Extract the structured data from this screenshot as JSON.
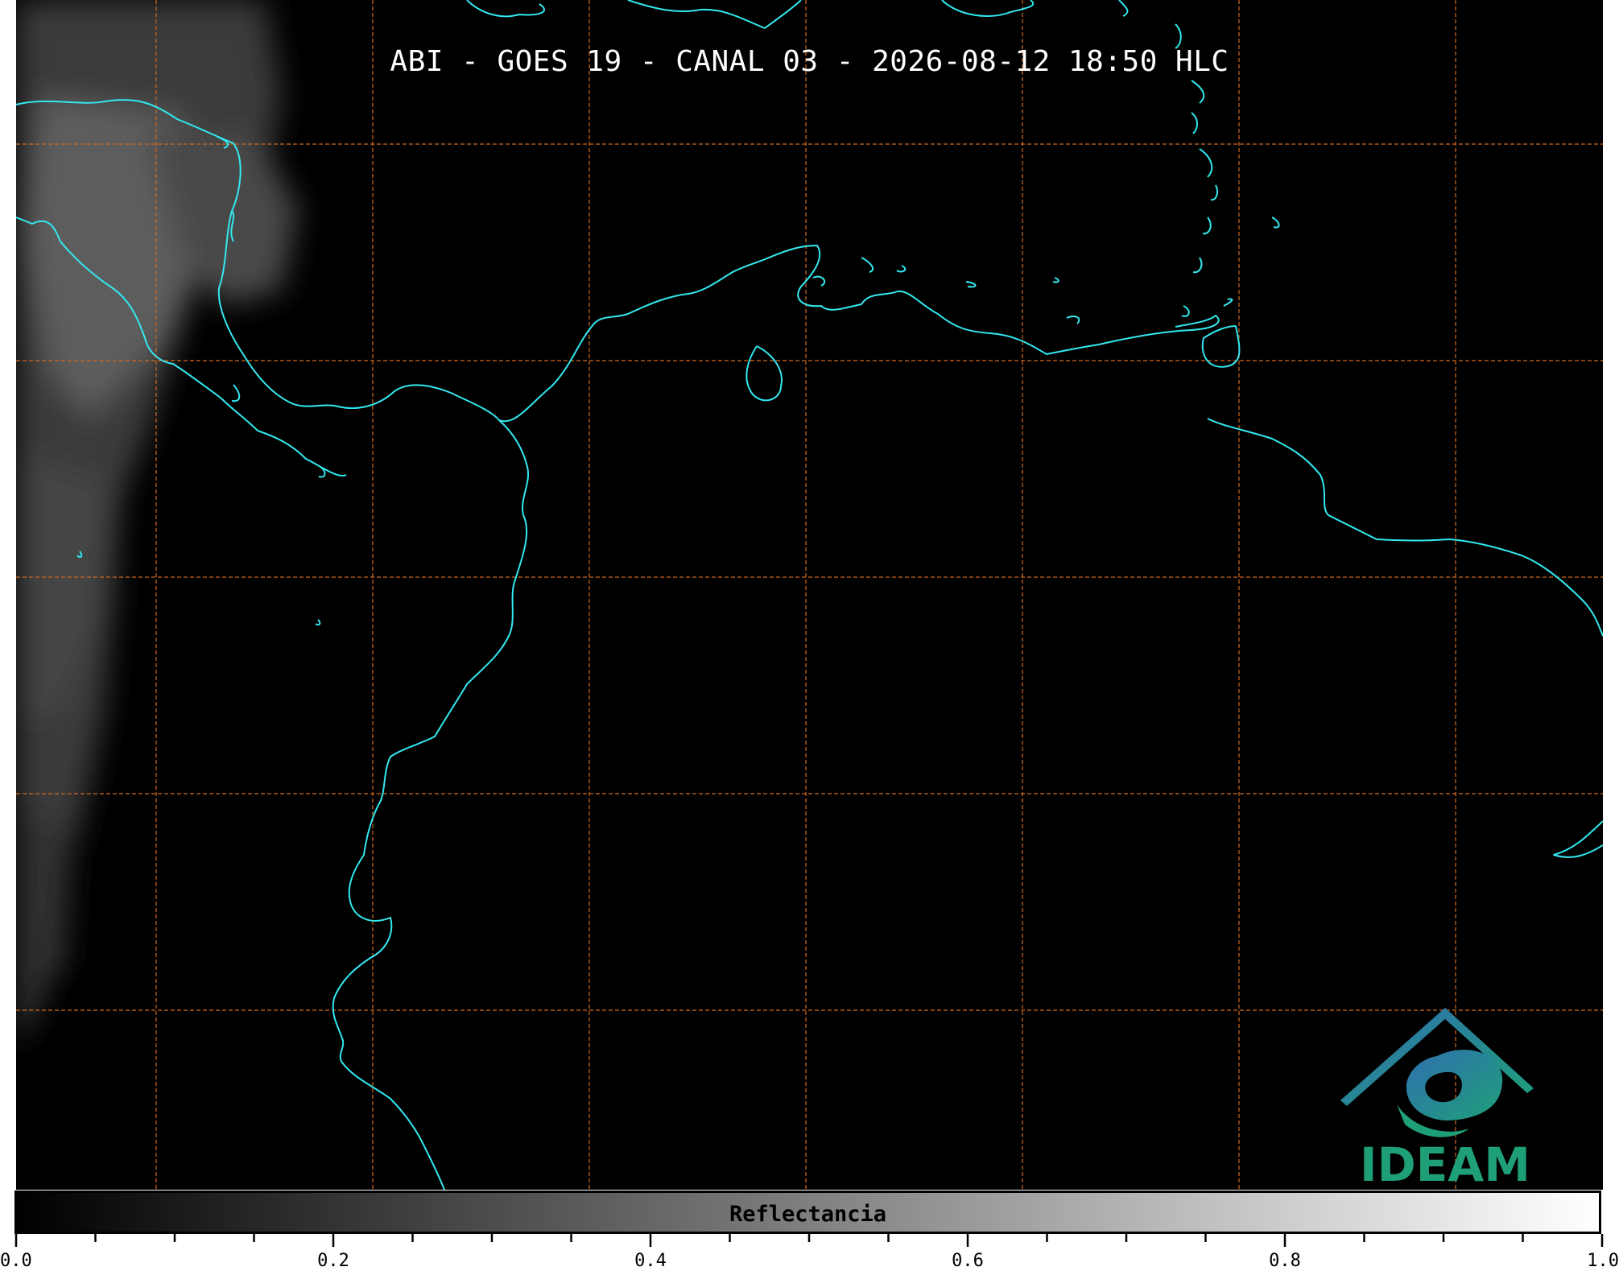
{
  "title": "ABI - GOES 19 - CANAL 03 - 2026-08-12 18:50 HLC",
  "logo": {
    "text": "IDEAM",
    "colors": [
      "#2f6fb0",
      "#1f9f78"
    ]
  },
  "colorbar": {
    "label": "Reflectancia",
    "range": [
      0.0,
      1.0
    ],
    "colormap": [
      "#000000",
      "#ffffff"
    ],
    "ticks": [
      {
        "value": 0.0,
        "label": "0.0"
      },
      {
        "value": 0.2,
        "label": "0.2"
      },
      {
        "value": 0.4,
        "label": "0.4"
      },
      {
        "value": 0.6,
        "label": "0.6"
      },
      {
        "value": 0.8,
        "label": "0.8"
      },
      {
        "value": 1.0,
        "label": "1.0"
      }
    ],
    "minor_step": 0.05
  },
  "map": {
    "background": "#000000",
    "coastline_color": "#33e8f0",
    "gridline_color": "#d2691e",
    "gridline_style": "dashed",
    "cloud_color": "#5a5a5a"
  }
}
